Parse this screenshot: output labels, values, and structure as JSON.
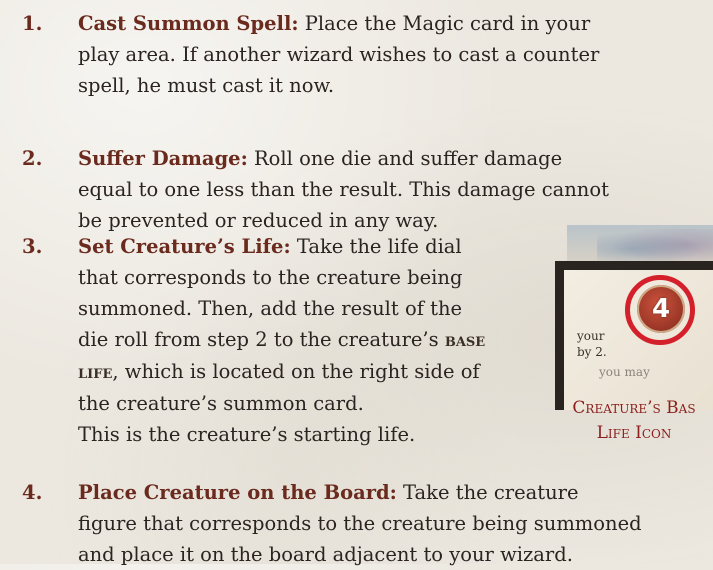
{
  "steps": [
    {
      "number": "1.",
      "heading": "Cast Summon Spell:",
      "line1": " Place the Magic card in your",
      "line2": "play area. If another wizard wishes to cast a counter",
      "line3": "spell, he must cast it now."
    },
    {
      "number": "2.",
      "heading": "Suffer Damage:",
      "line1": " Roll one die and suffer damage",
      "line2": "equal to one less than the result. This damage cannot",
      "line3": "be prevented or reduced in any way."
    },
    {
      "number": "3.",
      "heading": "Set Creature’s Life:",
      "line1": " Take the life dial",
      "line2": "that corresponds to the creature being",
      "line3": "summoned. Then, add the result of the",
      "line4a": "die roll from step ",
      "line4_step": "2",
      "line4b": " to the creature’s ",
      "base": "base",
      "life": "life",
      "line5b": ", which is located on the right side of",
      "line6": "the creature’s summon card.",
      "line7": "This is the creature’s starting life."
    },
    {
      "number": "4.",
      "heading": "Place Creature on the Board:",
      "line1": " Take the creature",
      "line2": "figure that corresponds to the creature being summoned",
      "line3": "and place it on the board adjacent to your wizard."
    }
  ],
  "figure": {
    "dial_value": "4",
    "card_text_1": "your",
    "card_text_2": "by 2.",
    "card_text_3": "you may",
    "caption_line1": "Creature’s Bas",
    "caption_line2": "Life Icon",
    "ring_color": "#d4202b",
    "dial_color": "#9a2a18"
  },
  "colors": {
    "heading": "#6b2a1e",
    "body": "#2b2320",
    "caption": "#8a1f1c",
    "background": "#ece8e0"
  }
}
